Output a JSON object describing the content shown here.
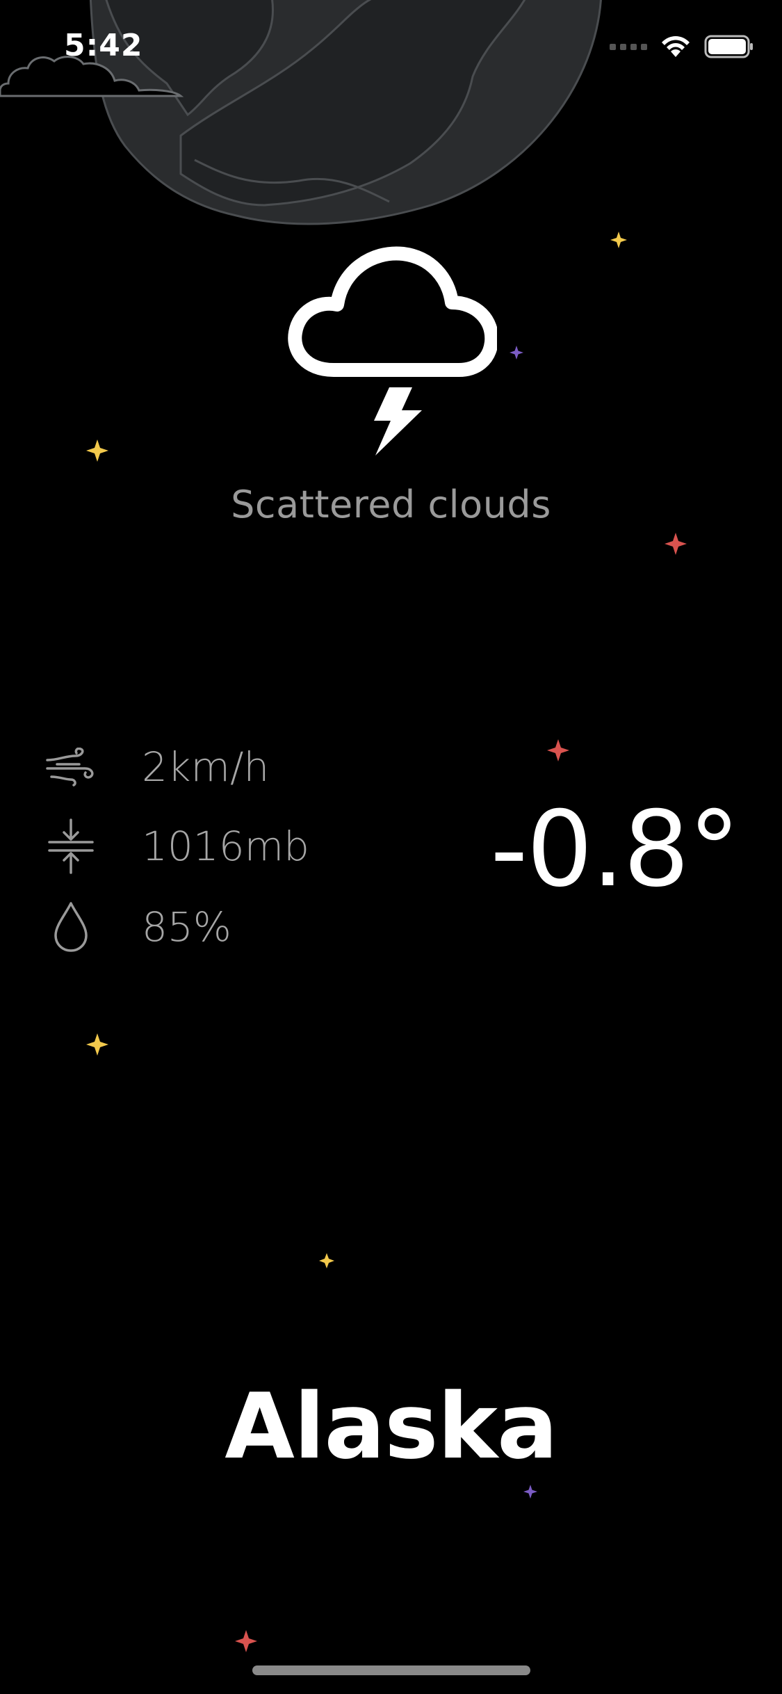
{
  "status_bar": {
    "time": "5:42"
  },
  "weather": {
    "condition": "Scattered clouds",
    "icon": "cloud-lightning-icon",
    "temperature": "-0.8°",
    "city": "Alaska"
  },
  "stats": [
    {
      "icon": "wind-icon",
      "value": "2km/h"
    },
    {
      "icon": "pressure-icon",
      "value": "1016mb"
    },
    {
      "icon": "humidity-drop-icon",
      "value": "85%"
    }
  ],
  "colors": {
    "background": "#000000",
    "planet": "#2a2c2e",
    "planet_outline": "#4a4d50",
    "star_yellow": "#f2c94c",
    "star_red": "#d9534f",
    "star_purple": "#7b5cc4",
    "muted_text": "#9a9a9a"
  }
}
